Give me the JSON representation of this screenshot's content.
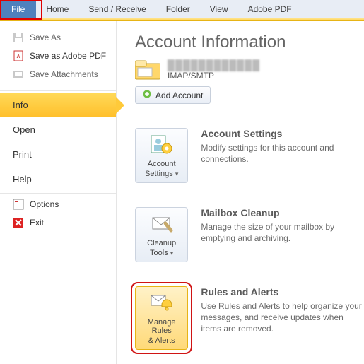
{
  "ribbon": {
    "tabs": [
      "File",
      "Home",
      "Send / Receive",
      "Folder",
      "View",
      "Adobe PDF"
    ]
  },
  "backstage": {
    "quick": {
      "save_as": "Save As",
      "save_pdf": "Save as Adobe PDF",
      "save_attach": "Save Attachments"
    },
    "nav": {
      "info": "Info",
      "open": "Open",
      "print": "Print",
      "help": "Help"
    },
    "footer": {
      "options": "Options",
      "exit": "Exit"
    }
  },
  "content": {
    "title": "Account Information",
    "account": {
      "name_masked": "████████████",
      "protocol": "IMAP/SMTP"
    },
    "add_account": "Add Account",
    "settings": {
      "btn_l1": "Account",
      "btn_l2": "Settings",
      "heading": "Account Settings",
      "body": "Modify settings for this account and connections."
    },
    "cleanup": {
      "btn_l1": "Cleanup",
      "btn_l2": "Tools",
      "heading": "Mailbox Cleanup",
      "body": "Manage the size of your mailbox by emptying and archiving."
    },
    "rules": {
      "btn_l1": "Manage Rules",
      "btn_l2": "& Alerts",
      "heading": "Rules and Alerts",
      "body": "Use Rules and Alerts to help organize your messages, and receive updates when items are removed."
    }
  }
}
